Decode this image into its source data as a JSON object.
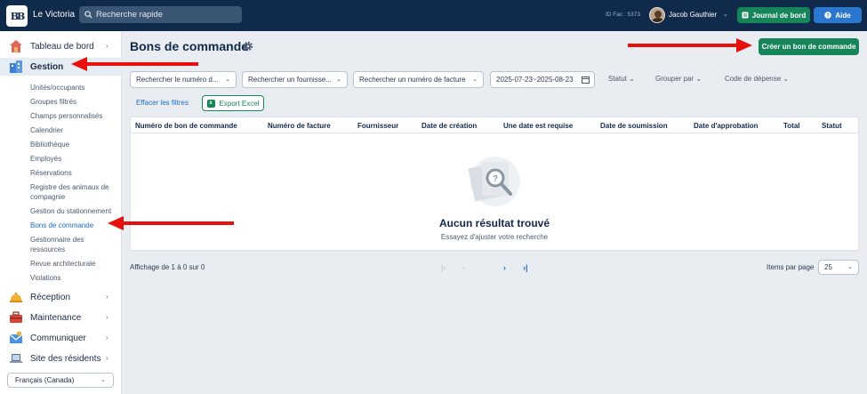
{
  "topbar": {
    "logo_text": "BB",
    "app_name": "Le Victoria",
    "search_placeholder": "Recherche rapide",
    "id_fac": "ID Fac : 5373",
    "user_name": "Jacob Gauthier",
    "journal_label": "Journal de bord",
    "aide_label": "Aide",
    "colors": {
      "bg": "#0f2a4a",
      "green": "#17855a",
      "blue": "#2b77d0"
    }
  },
  "sidebar": {
    "main_items": [
      {
        "label": "Tableau de bord",
        "icon": "house-icon"
      },
      {
        "label": "Gestion",
        "icon": "buildings-icon",
        "active": true
      },
      {
        "label": "Réception",
        "icon": "bell-icon"
      },
      {
        "label": "Maintenance",
        "icon": "toolbox-icon"
      },
      {
        "label": "Communiquer",
        "icon": "envelope-icon"
      },
      {
        "label": "Site des résidents",
        "icon": "laptop-icon"
      }
    ],
    "sub_items": [
      "Unités/occupants",
      "Groupes filtrés",
      "Champs personnalisés",
      "Calendrier",
      "Bibliothèque",
      "Employés",
      "Réservations",
      "Registre des animaux de compagnie",
      "Gestion du stationnement",
      "Bons de commande",
      "Gestionnaire des ressources",
      "Revue architecturale",
      "Violations"
    ],
    "active_sub": "Bons de commande",
    "language": "Français (Canada)"
  },
  "page": {
    "title": "Bons de commande",
    "create_button": "Créer un bon de commande"
  },
  "filters": {
    "po_number": "Rechercher le numéro d...",
    "supplier": "Rechercher un fournisse...",
    "invoice": "Rechercher un numéro de facture",
    "date_range": "2025-07-23~2025-08-23",
    "statut": "Statut",
    "group_by": "Grouper par",
    "expense_code": "Code de dépense",
    "clear": "Effacer les filtres",
    "export": "Export Excel"
  },
  "table": {
    "columns": [
      "Numéro de bon de commande",
      "Numéro de facture",
      "Fournisseur",
      "Date de création",
      "Une date est requise",
      "Date de soumission",
      "Date d'approbation",
      "Total",
      "Statut"
    ],
    "empty_title": "Aucun résultat trouvé",
    "empty_subtitle": "Essayez d'ajuster votre recherche"
  },
  "pagination": {
    "info": "Affichage de 1 à 0 sur 0",
    "items_per_page_label": "Items par page",
    "items_per_page": "25"
  }
}
